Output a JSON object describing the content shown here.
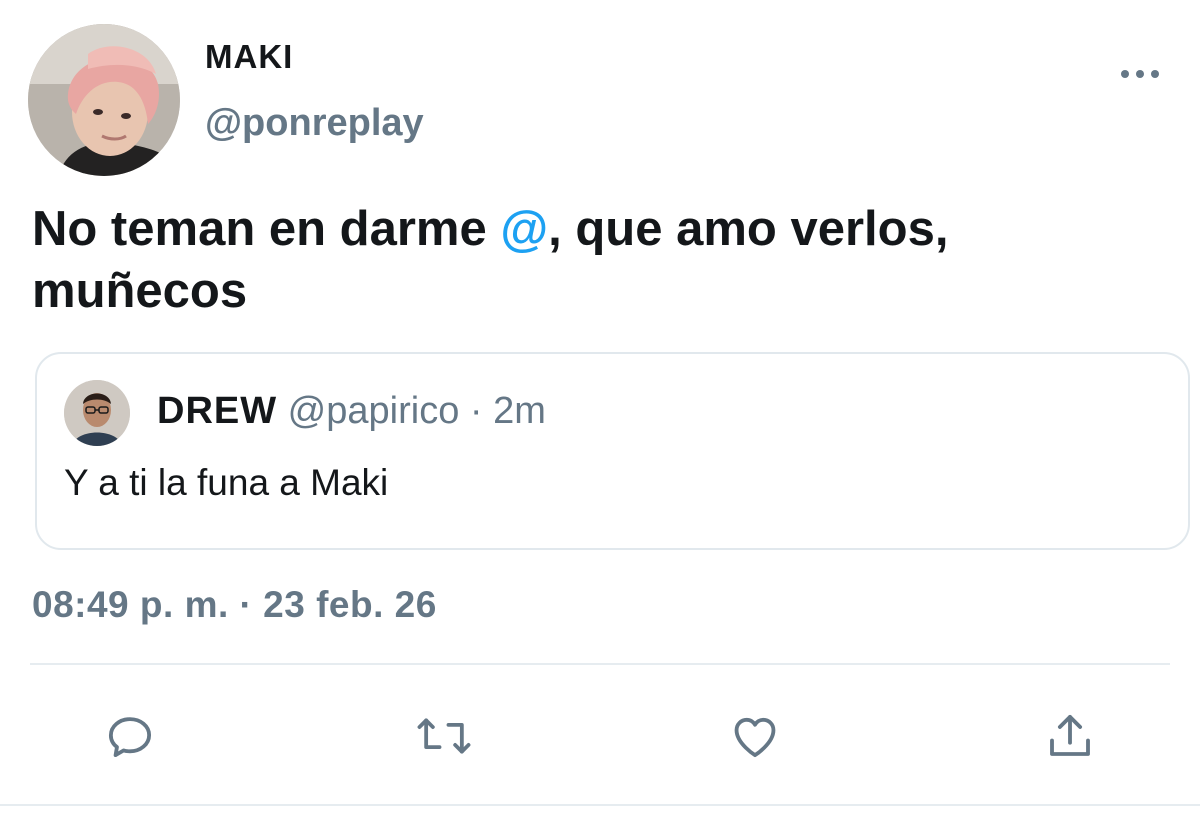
{
  "author": {
    "display_name": "MAKI",
    "handle": "@ponreplay",
    "avatar_icon": "user-avatar-pink-hair"
  },
  "tweet": {
    "text_before": "No teman en darme ",
    "mention": "@",
    "text_after": ", que amo verlos, muñecos"
  },
  "quote": {
    "display_name": "DREW",
    "handle": "@papirico",
    "separator": "·",
    "age": "2m",
    "text": "Y a ti la funa a Maki",
    "avatar_icon": "user-avatar-glasses"
  },
  "timestamp": {
    "time": "08:49 p. m.",
    "separator": "·",
    "date": "23 feb. 26"
  },
  "actions": {
    "reply_icon": "reply-icon",
    "retweet_icon": "retweet-icon",
    "like_icon": "heart-icon",
    "share_icon": "share-icon"
  },
  "colors": {
    "text": "#14171a",
    "secondary": "#657786",
    "accent": "#1da1f2",
    "border": "#e1e8ed"
  }
}
